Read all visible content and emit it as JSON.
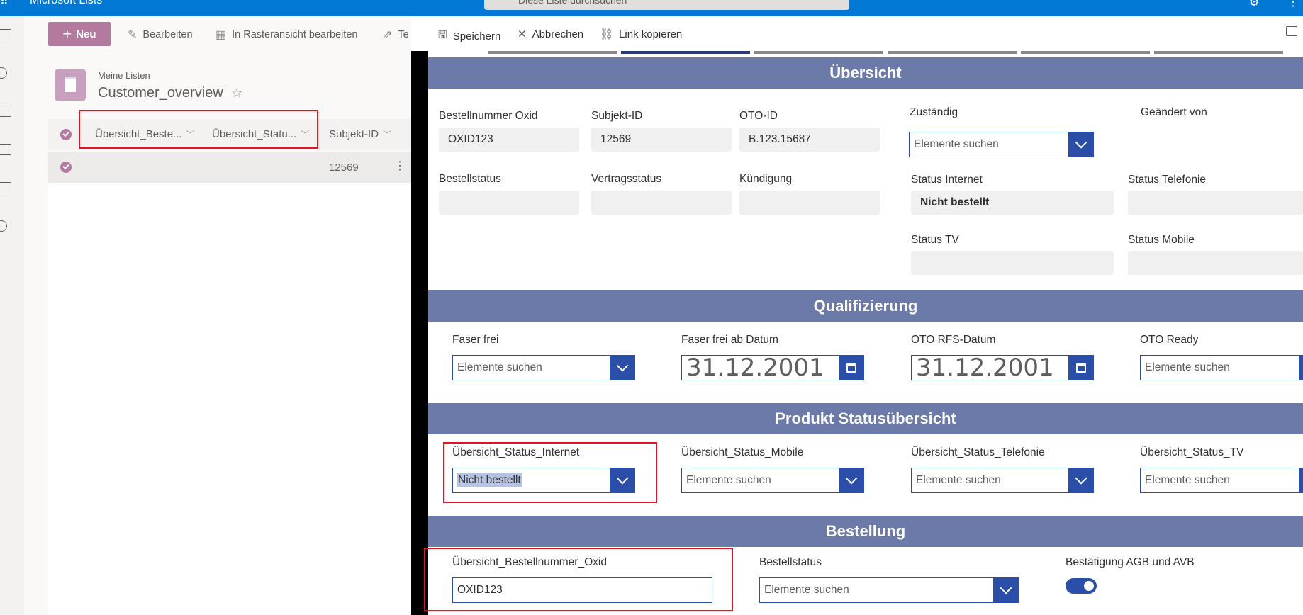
{
  "suite": {
    "app_name": "Microsoft Lists",
    "search_placeholder": "Diese Liste durchsuchen"
  },
  "list_commands": {
    "new_label": "Neu",
    "edit_label": "Bearbeiten",
    "grid_edit_label": "In Rasteransicht bearbeiten",
    "share_label": "Te"
  },
  "list": {
    "breadcrumb": "Meine Listen",
    "title": "Customer_overview",
    "columns": [
      "Übersicht_Beste...",
      "Übersicht_Statu...",
      "Subjekt-ID"
    ],
    "rows": [
      {
        "subjekt_id": "12569"
      }
    ]
  },
  "panel_commands": {
    "save_label": "Speichern",
    "cancel_label": "Abbrechen",
    "copy_link_label": "Link kopieren"
  },
  "sections": {
    "overview": "Übersicht",
    "qualification": "Qualifizierung",
    "product_status": "Produkt Statusübersicht",
    "order": "Bestellung"
  },
  "overview": {
    "bestellnummer_label": "Bestellnummer Oxid",
    "bestellnummer_value": "OXID123",
    "subjekt_label": "Subjekt-ID",
    "subjekt_value": "12569",
    "oto_label": "OTO-ID",
    "oto_value": "B.123.15687",
    "zustaendig_label": "Zuständig",
    "zustaendig_placeholder": "Elemente suchen",
    "geaendert_label": "Geändert von",
    "bestellstatus_label": "Bestellstatus",
    "bestellstatus_value": "",
    "vertragsstatus_label": "Vertragsstatus",
    "vertragsstatus_value": "",
    "kuendigung_label": "Kündigung",
    "kuendigung_value": "",
    "status_internet_label": "Status Internet",
    "status_internet_value": "Nicht bestellt",
    "status_telefonie_label": "Status Telefonie",
    "status_telefonie_value": "",
    "status_tv_label": "Status TV",
    "status_tv_value": "",
    "status_mobile_label": "Status Mobile",
    "status_mobile_value": ""
  },
  "qualification": {
    "faser_frei_label": "Faser frei",
    "faser_frei_placeholder": "Elemente suchen",
    "faser_datum_label": "Faser frei ab Datum",
    "faser_datum_value": "31.12.2001",
    "rfs_label": "OTO RFS-Datum",
    "rfs_value": "31.12.2001",
    "oto_ready_label": "OTO Ready",
    "oto_ready_placeholder": "Elemente suchen"
  },
  "product_status": {
    "internet_label": "Übersicht_Status_Internet",
    "internet_value": "Nicht bestellt",
    "mobile_label": "Übersicht_Status_Mobile",
    "mobile_placeholder": "Elemente suchen",
    "telefonie_label": "Übersicht_Status_Telefonie",
    "telefonie_placeholder": "Elemente suchen",
    "tv_label": "Übersicht_Status_TV",
    "tv_placeholder": "Elemente suchen"
  },
  "order": {
    "bestellnummer_label": "Übersicht_Bestellnummer_Oxid",
    "bestellnummer_value": "OXID123",
    "bestellstatus_label": "Bestellstatus",
    "bestellstatus_placeholder": "Elemente suchen",
    "agb_label": "Bestätigung AGB und AVB",
    "agb_on": true
  },
  "colors": {
    "suite_blue": "#0078d4",
    "accent_purple": "#b4799f",
    "section_band": "#6b7aa8",
    "control_blue": "#2b4fa8",
    "highlight_red": "#e81123"
  }
}
